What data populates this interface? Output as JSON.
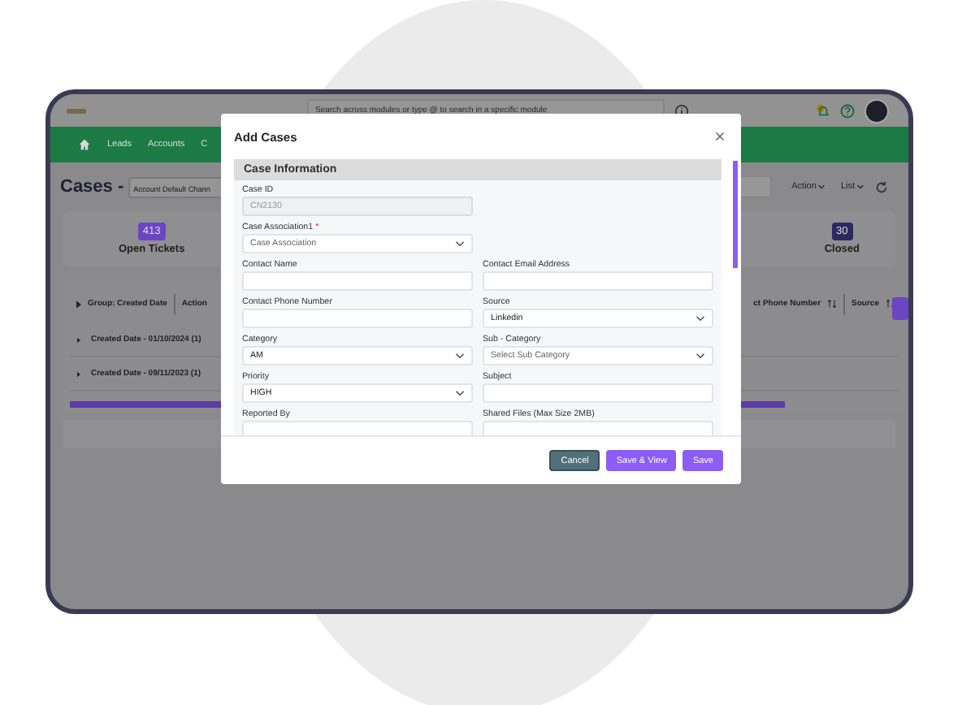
{
  "topbar": {
    "search_placeholder": "Search across modules or type @ to search in a specific module"
  },
  "nav": {
    "items": [
      "Leads",
      "Accounts",
      "C"
    ]
  },
  "page": {
    "title": "Cases -",
    "view_select": "Account Default Chann",
    "actions": [
      "Action",
      "List"
    ]
  },
  "stats": [
    {
      "count": "413",
      "label": "Open Tickets",
      "color": "#6b45c4"
    },
    {
      "count": "30",
      "label": "Closed",
      "color": "#2e2860"
    }
  ],
  "table": {
    "group_header": "Group: Created Date",
    "columns": [
      "Action",
      "ct Phone Number",
      "Source"
    ],
    "groups": [
      {
        "label": "Created Date - 01/10/2024 (1)",
        "expanded": false
      },
      {
        "label": "Created Date - 09/11/2023 (1)",
        "expanded": false
      }
    ]
  },
  "modal": {
    "title": "Add Cases",
    "section": "Case Information",
    "rows": [
      [
        {
          "label": "Case ID",
          "kind": "text",
          "value": "CN2130",
          "disabled": true
        }
      ],
      [
        {
          "label": "Case Association1",
          "required_mark": "*",
          "kind": "select",
          "placeholder": "Case Association",
          "disabled": false
        }
      ],
      [
        {
          "label": "Contact Name",
          "kind": "text",
          "disabled": false
        },
        {
          "label": "Contact Email Address",
          "kind": "text",
          "disabled": false
        }
      ],
      [
        {
          "label": "Contact Phone Number",
          "kind": "text",
          "disabled": false
        },
        {
          "label": "Source",
          "kind": "select",
          "value": "Linkedin",
          "disabled": false
        }
      ],
      [
        {
          "label": "Category",
          "kind": "select",
          "value": "AM",
          "disabled": false
        },
        {
          "label": "Sub - Category",
          "kind": "select",
          "placeholder": "Select Sub Category",
          "disabled": false
        }
      ],
      [
        {
          "label": "Priority",
          "kind": "select",
          "value": "HIGH",
          "disabled": false
        },
        {
          "label": "Subject",
          "kind": "text",
          "disabled": false
        }
      ],
      [
        {
          "label": "Reported By",
          "kind": "text",
          "disabled": false
        },
        {
          "label": "Shared Files (Max Size 2MB)",
          "kind": "text",
          "disabled": false
        }
      ]
    ],
    "buttons": [
      {
        "label": "Cancel",
        "kind": "secondary"
      },
      {
        "label": "Save & View",
        "kind": "primary"
      },
      {
        "label": "Save",
        "kind": "primary"
      }
    ]
  }
}
